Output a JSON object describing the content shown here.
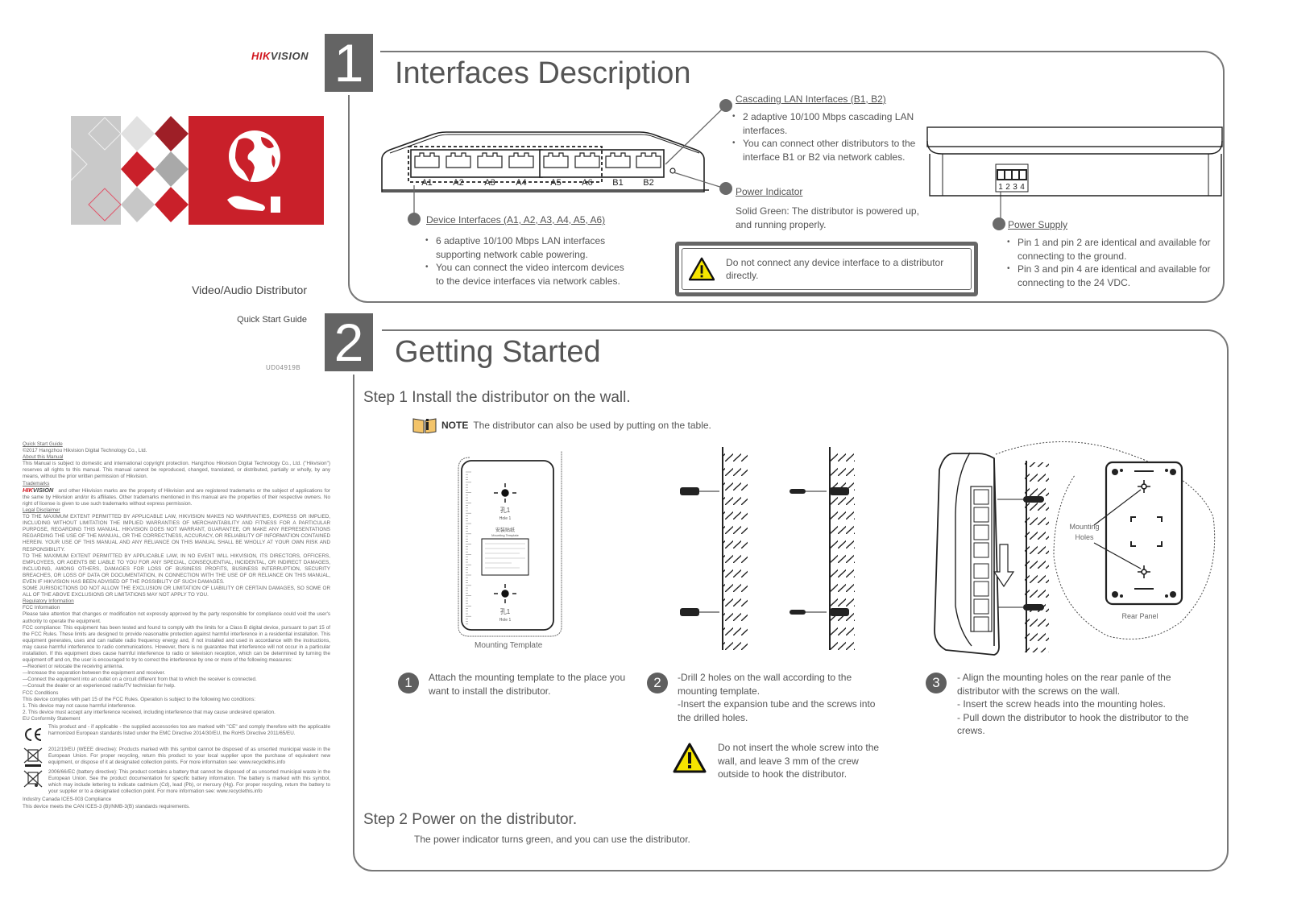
{
  "cover": {
    "brand_hik": "HIK",
    "brand_vision": "VISION",
    "product_name": "Video/Audio Distributor",
    "guide_name": "Quick Start Guide",
    "doc_code": "UD04919B",
    "brand_color": "#d0121b"
  },
  "legal": {
    "qsg_heading": "Quick Start Guide",
    "copyright": "©2017 Hangzhou Hikvision Digital Technology Co., Ltd.",
    "about_heading": "About this Manual",
    "about_text": "This Manual is subject to domestic and international copyright protection. Hangzhou Hikvision Digital Technology Co., Ltd. (\"Hikvision\") reserves all rights to this manual. This manual cannot be reproduced, changed, translated, or distributed, partially or wholly, by any means, without the prior written permission of Hikvision.",
    "trademarks_heading": "Trademarks",
    "trademarks_text": "and other Hikvision marks are the property of Hikvision and are registered trademarks or the subject of applications for the same by Hikvision and/or its affiliates. Other trademarks mentioned in this manual are the properties of their respective owners. No right of license is given to use such trademarks without express permission.",
    "disclaimer_heading": "Legal Disclaimer",
    "disclaimer_1": "TO THE MAXIMUM EXTENT PERMITTED BY APPLICABLE LAW, HIKVISION MAKES NO WARRANTIES, EXPRESS OR IMPLIED, INCLUDING WITHOUT LIMITATION THE IMPLIED WARRANTIES OF MERCHANTABILITY AND FITNESS FOR A PARTICULAR PURPOSE, REGARDING THIS MANUAL. HIKVISION DOES NOT WARRANT, GUARANTEE, OR MAKE ANY REPRESENTATIONS REGARDING THE USE OF THE MANUAL, OR THE CORRECTNESS, ACCURACY, OR RELIABILITY OF INFORMATION CONTAINED HEREIN. YOUR USE OF THIS MANUAL AND ANY RELIANCE ON THIS MANUAL SHALL BE WHOLLY AT YOUR OWN RISK AND RESPONSIBILITY.",
    "disclaimer_2": "TO THE MAXIMUM EXTENT PERMITTED BY APPLICABLE LAW, IN NO EVENT WILL HIKVISION, ITS DIRECTORS, OFFICERS, EMPLOYEES, OR AGENTS BE LIABLE TO YOU FOR ANY SPECIAL, CONSEQUENTIAL, INCIDENTAL, OR INDIRECT DAMAGES, INCLUDING, AMONG OTHERS, DAMAGES FOR LOSS OF BUSINESS PROFITS, BUSINESS INTERRUPTION, SECURITY BREACHES, OR LOSS OF DATA OR DOCUMENTATION, IN CONNECTION WITH THE USE OF OR RELIANCE ON THIS MANUAL, EVEN IF HIKVISION HAS BEEN ADVISED OF THE POSSIBILITY OF SUCH DAMAGES.",
    "disclaimer_3": "SOME JURISDICTIONS DO NOT ALLOW THE EXCLUSION OR LIMITATION OF LIABILITY OR CERTAIN DAMAGES, SO SOME OR ALL OF THE ABOVE EXCLUSIONS OR LIMITATIONS MAY NOT APPLY TO YOU.",
    "regulatory_heading": "Regulatory Information",
    "fcc_info": "FCC Information",
    "fcc_attention": "Please take attention that changes or modification not expressly approved by the party responsible for compliance could void the user's authority to operate the equipment.",
    "fcc_compliance": "FCC compliance: This equipment has been tested and found to comply with the limits for a Class B digital device, pursuant to part 15 of the FCC Rules. These limits are designed to provide reasonable protection against harmful interference in a residential installation. This equipment generates, uses and can radiate radio frequency energy and, if not installed and used in accordance with the instructions, may cause harmful interference to radio communications. However, there is no guarantee that interference will not occur in a particular installation. If this equipment does cause harmful interference to radio or television reception, which can be determined by turning the equipment off and on, the user is encouraged to try to correct the interference by one or more of the following measures:",
    "measures": [
      "—Reorient or relocate the receiving antenna.",
      "—Increase the separation between the equipment and receiver.",
      "—Connect the equipment into an outlet on a circuit different from that to which the receiver is connected.",
      "—Consult the dealer or an experienced radio/TV technician for help."
    ],
    "fcc_conditions_heading": "FCC Conditions",
    "fcc_conditions_intro": "This device complies with part 15 of the FCC Rules. Operation is subject to the following two conditions:",
    "conditions": [
      "1. This device may not cause harmful interference.",
      "2. This device must accept any interference received, including interference that may cause undesired operation."
    ],
    "eu_heading": "EU Conformity Statement",
    "ce_text": "This product and - if applicable - the supplied accessories too are marked with \"CE\" and comply therefore with the applicable harmonized European standards listed under the EMC Directive 2014/30/EU, the RoHS Directive 2011/65/EU.",
    "weee_text": "2012/19/EU (WEEE directive): Products marked with this symbol cannot be disposed of as unsorted municipal waste in the European Union. For proper recycling, return this product to your local supplier upon the purchase of equivalent new equipment, or dispose of it at designated collection points. For more information see: www.recyclethis.info",
    "battery_text": "2006/66/EC (battery directive): This product contains a battery that cannot be disposed of as unsorted municipal waste in the European Union. See the product documentation for specific battery information. The battery is marked with this symbol, which may include lettering to indicate cadmium (Cd), lead (Pb), or mercury (Hg). For proper recycling, return the battery to your supplier or to a designated collection point. For more information see: www.recyclethis.info",
    "canada_heading": "Industry Canada ICES-003 Compliance",
    "canada_text": "This device meets the CAN ICES-3 (B)/NMB-3(B) standards requirements."
  },
  "section1": {
    "number": "1",
    "title": "Interfaces Description",
    "port_labels": [
      "A1",
      "A2",
      "A3",
      "A4",
      "A5",
      "A6",
      "B1",
      "B2"
    ],
    "pin_labels": [
      "1",
      "2",
      "3",
      "4"
    ],
    "device_interfaces": {
      "title": "Device Interfaces (A1, A2, A3, A4, A5, A6)",
      "bullets": [
        "6 adaptive 10/100 Mbps LAN interfaces supporting network cable powering.",
        "You can connect the video intercom devices to the device interfaces via network cables."
      ]
    },
    "cascading": {
      "title": "Cascading LAN Interfaces (B1, B2)",
      "bullets": [
        "2 adaptive 10/100 Mbps cascading LAN interfaces.",
        "You can connect other distributors to the interface B1 or B2 via network cables."
      ]
    },
    "power_indicator": {
      "title": "Power Indicator",
      "text": "Solid Green: The distributor is powered up, and running properly."
    },
    "power_supply": {
      "title": "Power Supply",
      "bullets": [
        "Pin 1 and pin 2 are identical and available for connecting to the ground.",
        "Pin 3 and pin 4 are identical and available for connecting to the 24 VDC."
      ]
    },
    "warning": "Do not connect any device interface to a distributor directly."
  },
  "section2": {
    "number": "2",
    "title": "Getting Started",
    "step1_heading": "Step 1 Install the distributor on the wall.",
    "note_label": "NOTE",
    "note_text": "The distributor can also be used by putting on the table.",
    "template_caption": "Mounting Template",
    "template_hole_cn": "孔1",
    "template_hole_en": "Hole 1",
    "template_label_cn": "安装贴纸",
    "template_label_en": "Mounting Template",
    "mounting_holes_label_1": "Mounting",
    "mounting_holes_label_2": "Holes",
    "rear_panel_caption": "Rear Panel",
    "steps": [
      {
        "number": "1",
        "lines": [
          "Attach the mounting template to the place you want to install the distributor."
        ]
      },
      {
        "number": "2",
        "lines": [
          "-Drill 2 holes on the wall according to the mounting template.",
          "-Insert the expansion tube and the screws into the drilled holes."
        ]
      },
      {
        "number": "3",
        "lines": [
          "- Align the mounting holes on the rear panle of the distributor with the screws on the wall.",
          "- Insert the screw heads into the mounting holes.",
          "- Pull down the distributor to hook the distributor to the crews."
        ]
      }
    ],
    "step2_warning": "Do not insert the whole screw into the wall, and leave 3 mm of the crew outside to hook the distributor.",
    "step2_heading": "Step 2 Power on the distributor.",
    "step2_text": "The power indicator turns green, and you can use the distributor."
  }
}
